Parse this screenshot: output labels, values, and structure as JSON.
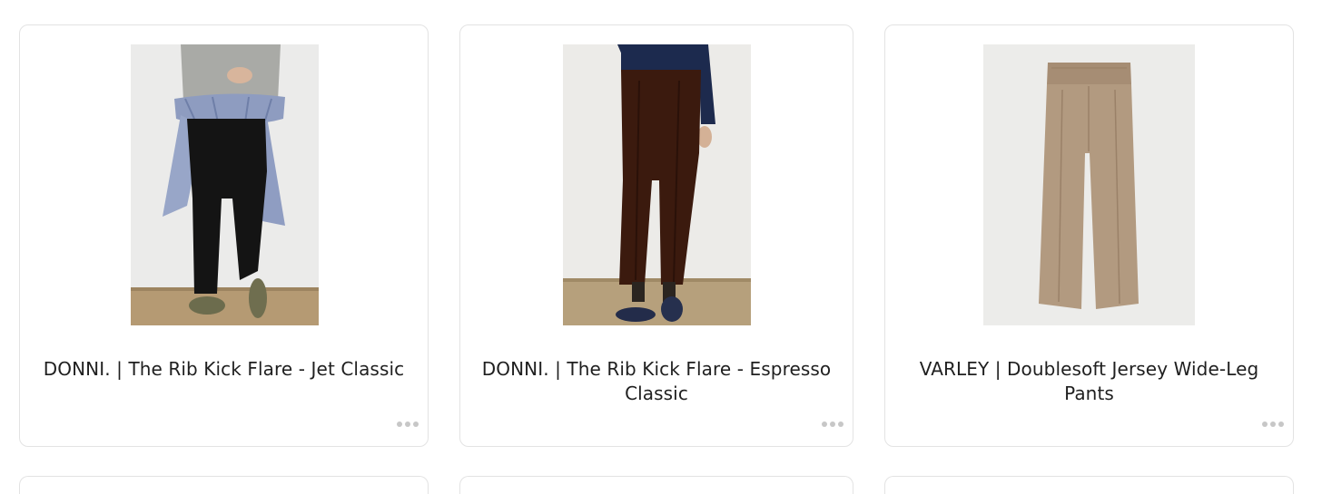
{
  "products": [
    {
      "title": "DONNI. | The Rib Kick Flare - Jet Classic",
      "more_icon": "more-horizontal-icon"
    },
    {
      "title": "DONNI. | The Rib Kick Flare - Espresso Classic",
      "more_icon": "more-horizontal-icon"
    },
    {
      "title": "VARLEY | Doublesoft Jersey Wide-Leg Pants",
      "more_icon": "more-horizontal-icon"
    }
  ],
  "colors": {
    "card_border": "#e3e3e3",
    "text": "#1f1f1f",
    "dots": "#c7c7c7"
  }
}
